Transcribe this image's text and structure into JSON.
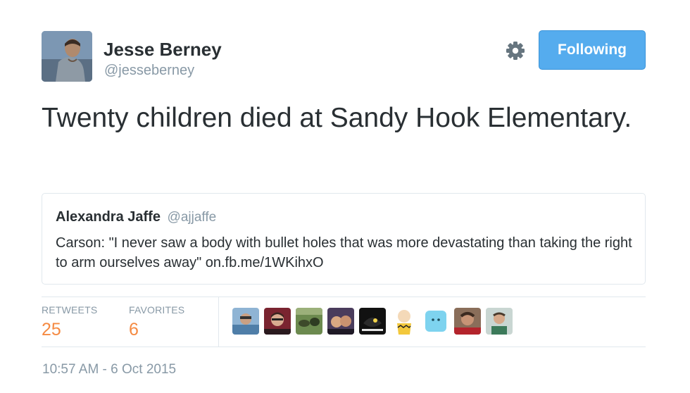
{
  "author": {
    "name": "Jesse Berney",
    "handle": "@jesseberney"
  },
  "actions": {
    "settings_icon": "gear-icon",
    "follow_label": "Following",
    "follow_color": "#55acee"
  },
  "tweet": {
    "text": "Twenty children died at Sandy Hook Elementary."
  },
  "quoted_tweet": {
    "name": "Alexandra Jaffe",
    "handle": "@ajjaffe",
    "text": "Carson: \"I never saw a body with bullet holes that was more devastating than taking the right to arm ourselves away\" on.fb.me/1WKihxO"
  },
  "stats": {
    "retweets_label": "RETWEETS",
    "retweets_count": "25",
    "favorites_label": "FAVORITES",
    "favorites_count": "6",
    "count_color": "#f58a42"
  },
  "favoriters": [
    {
      "name": "favoriter-1"
    },
    {
      "name": "favoriter-2"
    },
    {
      "name": "favoriter-3"
    },
    {
      "name": "favoriter-4"
    },
    {
      "name": "favoriter-5"
    },
    {
      "name": "favoriter-6"
    },
    {
      "name": "favoriter-7"
    },
    {
      "name": "favoriter-8"
    },
    {
      "name": "favoriter-9"
    }
  ],
  "timestamp": "10:57 AM - 6 Oct 2015"
}
